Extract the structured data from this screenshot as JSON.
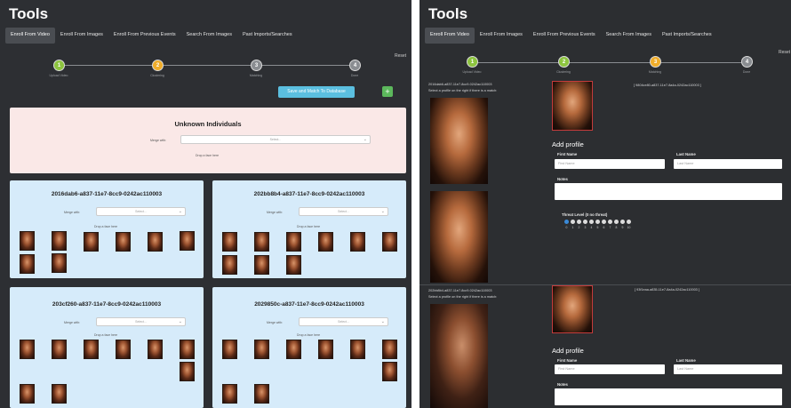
{
  "left": {
    "title": "Tools",
    "tabs": [
      "Enroll From Video",
      "Enroll From Images",
      "Enroll From Previous Events",
      "Search From Images",
      "Past Imports/Searches"
    ],
    "steps": [
      {
        "num": "1",
        "label": "Upload Video",
        "color": "#8dc43f"
      },
      {
        "num": "2",
        "label": "Clustering",
        "color": "#f0ad2a"
      },
      {
        "num": "3",
        "label": "Matching",
        "color": "#8a8d91"
      },
      {
        "num": "4",
        "label": "Done",
        "color": "#8a8d91"
      }
    ],
    "reset": "Reset",
    "next_button": "Save and Match To Database",
    "plus_button": "+",
    "unknown": {
      "title": "Unknown Individuals",
      "merge_label": "Merge with:",
      "select_placeholder": "Select...",
      "drop_hint": "Drop a face here"
    },
    "clusters": [
      {
        "id": "2016dab6-a837-11e7-8cc9-0242ac110003",
        "merge_label": "Merge with:",
        "select_placeholder": "Select...",
        "drop_hint": "Drop a face here",
        "faces": 8
      },
      {
        "id": "202bb8b4-a837-11e7-8cc9-0242ac110003",
        "merge_label": "Merge with:",
        "select_placeholder": "Select...",
        "drop_hint": "Drop a face here",
        "faces": 9
      },
      {
        "id": "203cf260-a837-11e7-8cc9-0242ac110003",
        "merge_label": "Merge with:",
        "select_placeholder": "Select...",
        "drop_hint": "Drop a face here",
        "faces": 9
      },
      {
        "id": "2029850c-a837-11e7-8cc9-0242ac110003",
        "merge_label": "Merge with:",
        "select_placeholder": "Select...",
        "drop_hint": "Drop a face here",
        "faces": 9
      }
    ]
  },
  "right": {
    "title": "Tools",
    "tabs": [
      "Enroll From Video",
      "Enroll From Images",
      "Enroll From Previous Events",
      "Search From Images",
      "Past Imports/Searches"
    ],
    "steps": [
      {
        "num": "1",
        "label": "Upload Video",
        "color": "#8dc43f"
      },
      {
        "num": "2",
        "label": "Clustering",
        "color": "#8dc43f"
      },
      {
        "num": "3",
        "label": "Matching",
        "color": "#f0ad2a"
      },
      {
        "num": "4",
        "label": "Done",
        "color": "#8a8d91"
      }
    ],
    "reset": "Reset",
    "matches": [
      {
        "cluster_id": "2016dab6-a837-11e7-8cc9-0242ac110003",
        "hint": "Select a profile on the right if there is a match:",
        "match_id": "[ 9804ce80-a837-11e7-8a4a-0242ac110003 ]",
        "add_profile": "Add profile",
        "first_name_label": "First Name",
        "first_name_placeholder": "First Name",
        "last_name_label": "Last Name",
        "last_name_placeholder": "Last Name",
        "notes_label": "Notes",
        "threat_label": "Threat Level (0 no threat)",
        "threat_levels": [
          "0",
          "1",
          "2",
          "3",
          "4",
          "5",
          "6",
          "7",
          "8",
          "9",
          "10"
        ],
        "threat_selected": 0
      },
      {
        "cluster_id": "202bb8b4-a837-11e7-8cc9-0242ac110003",
        "hint": "Select a profile on the right if there is a match:",
        "match_id": "[ 93f1eaa-a835-11e7-8a4a-0242ac110003 ]",
        "add_profile": "Add profile",
        "first_name_label": "First Name",
        "first_name_placeholder": "First Name",
        "last_name_label": "Last Name",
        "last_name_placeholder": "Last Name",
        "notes_label": "Notes"
      }
    ]
  }
}
